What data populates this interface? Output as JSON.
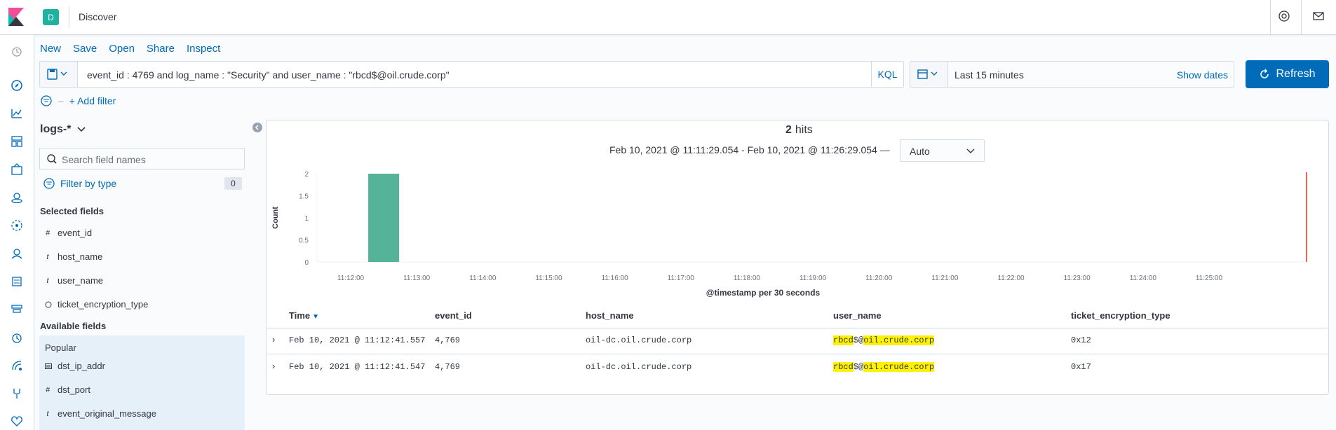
{
  "header": {
    "space_initial": "D",
    "app_title": "Discover"
  },
  "toolbar": {
    "links": [
      "New",
      "Save",
      "Open",
      "Share",
      "Inspect"
    ]
  },
  "query": {
    "text": "event_id : 4769 and log_name : \"Security\" and user_name : \"rbcd$@oil.crude.corp\"",
    "language": "KQL"
  },
  "time": {
    "range_label": "Last 15 minutes",
    "show_dates": "Show dates",
    "refresh": "Refresh"
  },
  "filters": {
    "add_filter": "+ Add filter"
  },
  "sidebar": {
    "index_pattern": "logs-*",
    "search_placeholder": "Search field names",
    "filter_by_type": "Filter by type",
    "filter_count": "0",
    "selected_title": "Selected fields",
    "selected_fields": [
      {
        "type": "#",
        "name": "event_id"
      },
      {
        "type": "t",
        "name": "host_name"
      },
      {
        "type": "t",
        "name": "user_name"
      },
      {
        "type": "?",
        "name": "ticket_encryption_type"
      }
    ],
    "available_title": "Available fields",
    "popular_label": "Popular",
    "popular_fields": [
      {
        "type": "ip",
        "name": "dst_ip_addr"
      },
      {
        "type": "#",
        "name": "dst_port"
      },
      {
        "type": "t",
        "name": "event_original_message"
      }
    ]
  },
  "results": {
    "hits_count": "2",
    "hits_label": "hits",
    "range_text": "Feb 10, 2021 @ 11:11:29.054 - Feb 10, 2021 @ 11:26:29.054 —",
    "interval": "Auto"
  },
  "chart_data": {
    "type": "bar",
    "categories": [
      "11:12:00",
      "11:13:00",
      "11:14:00",
      "11:15:00",
      "11:16:00",
      "11:17:00",
      "11:18:00",
      "11:19:00",
      "11:20:00",
      "11:21:00",
      "11:22:00",
      "11:23:00",
      "11:24:00",
      "11:25:00"
    ],
    "bars": [
      {
        "x": "11:12:30",
        "value": 2
      }
    ],
    "ylabel": "Count",
    "xlabel": "@timestamp per 30 seconds",
    "yticks": [
      "0",
      "0.5",
      "1",
      "1.5",
      "2"
    ],
    "ylim": [
      0,
      2
    ],
    "bar_color": "#54b399",
    "now_marker_color": "#e7664c"
  },
  "table": {
    "columns": [
      "Time",
      "event_id",
      "host_name",
      "user_name",
      "ticket_encryption_type"
    ],
    "rows": [
      {
        "time": "Feb 10, 2021 @ 11:12:41.557",
        "event_id": "4,769",
        "host_name": "oil-dc.oil.crude.corp",
        "user_a": "rbcd",
        "user_b": "$@",
        "user_c": "oil.crude.corp",
        "enc": "0x12"
      },
      {
        "time": "Feb 10, 2021 @ 11:12:41.547",
        "event_id": "4,769",
        "host_name": "oil-dc.oil.crude.corp",
        "user_a": "rbcd",
        "user_b": "$@",
        "user_c": "oil.crude.corp",
        "enc": "0x17"
      }
    ]
  }
}
